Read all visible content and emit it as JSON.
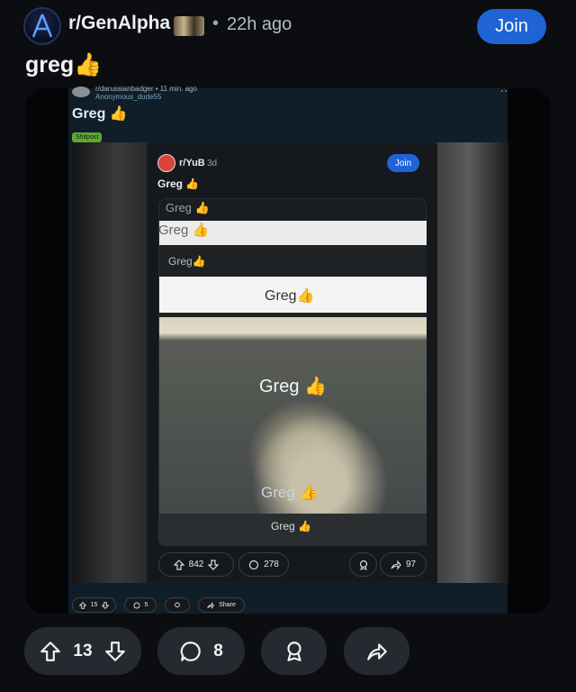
{
  "header": {
    "subreddit": "r/GenAlpha",
    "separator": "•",
    "time": "22h ago",
    "join_label": "Join"
  },
  "post": {
    "title": "greg",
    "title_emoji": "👍"
  },
  "media": {
    "inner_post": {
      "subreddit": "r/darussianbadger • 11 min. ago",
      "user": "Anonymous_dude55",
      "more": "··",
      "title": "Greg",
      "title_emoji": "👍",
      "flair": "Shitpost"
    },
    "repost": {
      "subreddit": "r/YuB",
      "time": "3d",
      "join_label": "Join",
      "title": "Greg",
      "title_emoji": "👍",
      "captions": [
        "Greg",
        "Greg",
        "Greg",
        "Greg",
        "Greg",
        "Greg",
        "Greg"
      ],
      "caption_emoji": "👍",
      "upvotes": "842",
      "comments": "278",
      "shares": "97"
    },
    "inner_actions": {
      "upvotes": "15",
      "comments": "5",
      "share_label": "Share"
    }
  },
  "actions": {
    "upvotes": "13",
    "comments": "8"
  },
  "colors": {
    "background": "#0b0d10",
    "accent": "#1f63d6",
    "button_bg": "#262a30",
    "flair": "#5fa832"
  }
}
